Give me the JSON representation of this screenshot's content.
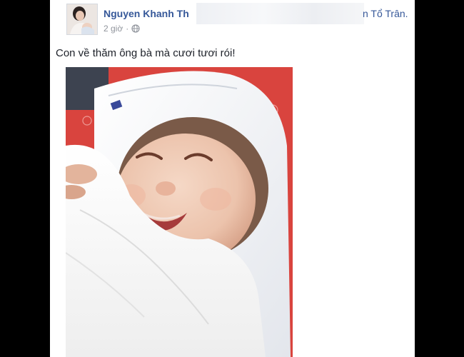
{
  "post": {
    "author": "Nguyen Khanh Th",
    "tagged_text": "n Tổ Trân.",
    "timestamp": "2 giờ",
    "audience_icon": "globe-icon",
    "text": "Con về thăm ông bà mà cươi tươi rói!"
  },
  "colors": {
    "link": "#365899",
    "meta": "#90949c",
    "body_text": "#1d2129",
    "backdrop": "#000000"
  }
}
